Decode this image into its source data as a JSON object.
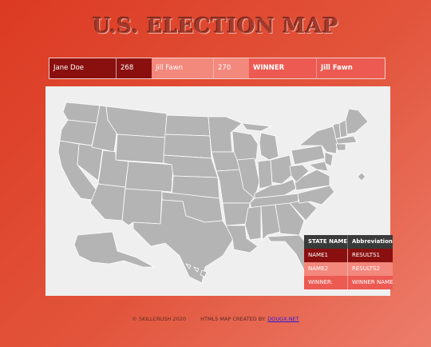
{
  "title": "U.S. ELECTION MAP",
  "results": {
    "candidate1_name": "Jane Doe",
    "candidate1_votes": "268",
    "candidate2_name": "Jill Fawn",
    "candidate2_votes": "270",
    "winner_label": "WINNER",
    "winner_name": "Jill Fawn"
  },
  "legend": {
    "header_state": "STATE NAME",
    "header_abbr": "Abbreviation",
    "row1_name": "NAME1",
    "row1_value": "RESULTS1",
    "row2_name": "NAME2",
    "row2_value": "RESULTS2",
    "row3_name": "WINNER:",
    "row3_value": "WINNER NAME"
  },
  "footer": {
    "copyright": "© SKILLCRUSH 2020",
    "created_by": "HTML5 MAP CREATED BY:",
    "link_text": "DOUGX.NET"
  },
  "colors": {
    "candidate1": "#8a1010",
    "candidate2": "#f3887c",
    "winner": "#ec5a52",
    "state_default": "#b4b4b4",
    "map_background": "#efefef"
  }
}
